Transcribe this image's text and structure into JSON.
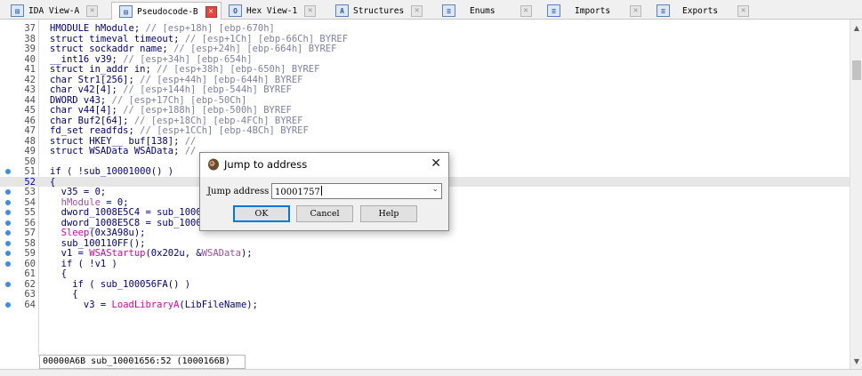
{
  "tabs": [
    {
      "label": "IDA View-A",
      "icon": "ida-view-icon",
      "active": false
    },
    {
      "label": "Pseudocode-B",
      "icon": "pseudocode-icon",
      "active": true
    },
    {
      "label": "Hex View-1",
      "icon": "hex-view-icon",
      "active": false
    },
    {
      "label": "Structures",
      "icon": "structures-icon",
      "active": false
    },
    {
      "label": "Enums",
      "icon": "enums-icon",
      "active": false
    },
    {
      "label": "Imports",
      "icon": "imports-icon",
      "active": false
    },
    {
      "label": "Exports",
      "icon": "exports-icon",
      "active": false
    }
  ],
  "code_lines": [
    {
      "num": "37",
      "dot": false,
      "text": "HMODULE hModule; // [esp+18h] [ebp-670h]"
    },
    {
      "num": "38",
      "dot": false,
      "text": "struct timeval timeout; // [esp+1Ch] [ebp-66Ch] BYREF"
    },
    {
      "num": "39",
      "dot": false,
      "text": "struct sockaddr name; // [esp+24h] [ebp-664h] BYREF"
    },
    {
      "num": "40",
      "dot": false,
      "text": "__int16 v39; // [esp+34h] [ebp-654h]"
    },
    {
      "num": "41",
      "dot": false,
      "text": "struct in_addr in; // [esp+38h] [ebp-650h] BYREF"
    },
    {
      "num": "42",
      "dot": false,
      "text": "char Str1[256]; // [esp+44h] [ebp-644h] BYREF"
    },
    {
      "num": "43",
      "dot": false,
      "text": "char v42[4]; // [esp+144h] [ebp-544h] BYREF"
    },
    {
      "num": "44",
      "dot": false,
      "text": "DWORD v43; // [esp+17Ch] [ebp-50Ch]"
    },
    {
      "num": "45",
      "dot": false,
      "text": "char v44[4]; // [esp+188h] [ebp-500h] BYREF"
    },
    {
      "num": "46",
      "dot": false,
      "text": "char Buf2[64]; // [esp+18Ch] [ebp-4FCh] BYREF"
    },
    {
      "num": "47",
      "dot": false,
      "text": "fd_set readfds; // [esp+1CCh] [ebp-4BCh] BYREF"
    },
    {
      "num": "48",
      "dot": false,
      "text": "struct HKEY__ buf[138]; //"
    },
    {
      "num": "49",
      "dot": false,
      "text": "struct WSAData WSAData; //"
    },
    {
      "num": "50",
      "dot": false,
      "text": ""
    },
    {
      "num": "51",
      "dot": true,
      "text": "if ( !sub_10001000() )"
    },
    {
      "num": "52",
      "dot": false,
      "text": "{"
    },
    {
      "num": "53",
      "dot": true,
      "text": "  v35 = 0;"
    },
    {
      "num": "54",
      "dot": true,
      "text": "  hModule = 0;"
    },
    {
      "num": "55",
      "dot": true,
      "text": "  dword_1008E5C4 = sub_10003695();"
    },
    {
      "num": "56",
      "dot": true,
      "text": "  dword_1008E5C8 = sub_100036C3();"
    },
    {
      "num": "57",
      "dot": true,
      "text": "  Sleep(0x3A98u);"
    },
    {
      "num": "58",
      "dot": true,
      "text": "  sub_100110FF();"
    },
    {
      "num": "59",
      "dot": true,
      "text": "  v1 = WSAStartup(0x202u, &WSAData);"
    },
    {
      "num": "60",
      "dot": true,
      "text": "  if ( !v1 )"
    },
    {
      "num": "61",
      "dot": false,
      "text": "  {"
    },
    {
      "num": "62",
      "dot": true,
      "text": "    if ( sub_100056FA() )"
    },
    {
      "num": "63",
      "dot": false,
      "text": "    {"
    },
    {
      "num": "64",
      "dot": true,
      "text": "      v3 = LoadLibraryA(LibFileName);"
    }
  ],
  "status_text": "00000A6B sub_10001656:52 (1000166B)",
  "dialog": {
    "title": "Jump to address",
    "close_glyph": "✕",
    "label_prefix": "J",
    "label_rest": "ump address",
    "address_value": "10001757",
    "ok_label": "OK",
    "cancel_label": "Cancel",
    "help_label": "Help"
  },
  "colors": {
    "keyword": "#000080",
    "comment": "#7f7fa8",
    "function_call": "#e000a8",
    "dot_marker": "#3d8ee0",
    "active_tab_close": "#e8453c"
  }
}
